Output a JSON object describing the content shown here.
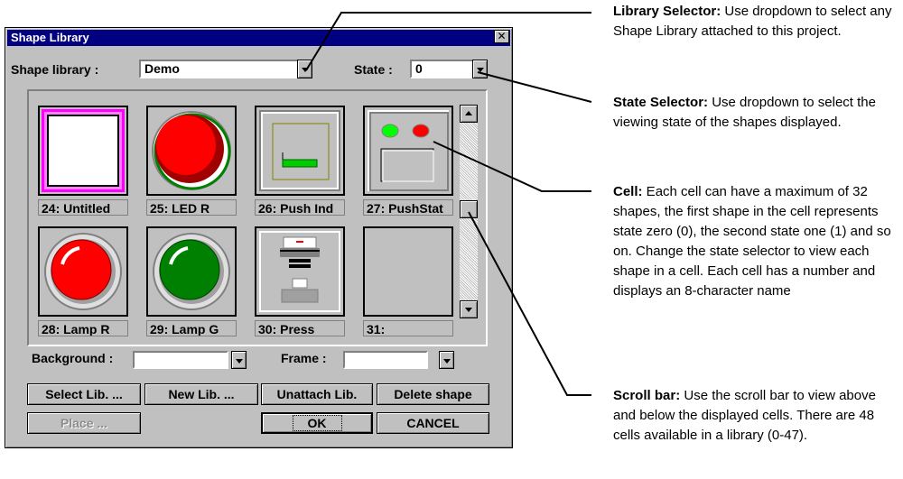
{
  "window": {
    "title": "Shape Library",
    "close": "✕"
  },
  "top": {
    "library_label": "Shape library :",
    "library_value": "Demo",
    "state_label": "State :",
    "state_value": "0"
  },
  "cells": [
    {
      "label": "24: Untitled"
    },
    {
      "label": "25: LED R"
    },
    {
      "label": "26: Push Ind"
    },
    {
      "label": "27: PushStat"
    },
    {
      "label": "28: Lamp R"
    },
    {
      "label": "29: Lamp G"
    },
    {
      "label": "30: Press"
    },
    {
      "label": "31:"
    }
  ],
  "bottom": {
    "background_label": "Background :",
    "frame_label": "Frame :"
  },
  "buttons": {
    "select_lib": "Select Lib. ...",
    "new_lib": "New Lib. ...",
    "unattach_lib": "Unattach Lib.",
    "delete_shape": "Delete shape",
    "place": "Place ...",
    "ok": "OK",
    "cancel": "CANCEL"
  },
  "callouts": {
    "library": {
      "title": "Library Selector:",
      "text": " Use dropdown to select any Shape Library attached to this project."
    },
    "state": {
      "title": "State Selector:",
      "text": " Use dropdown to select the viewing state of the shapes displayed."
    },
    "cell": {
      "title": "Cell:",
      "text": " Each cell can have a maximum of 32 shapes, the first shape in the cell represents state zero (0), the second state one (1) and so on. Change the state selector to view each shape in a cell. Each cell has a number and displays an 8-character name"
    },
    "scroll": {
      "title": "Scroll bar:",
      "text": " Use the scroll bar to view above and below the displayed cells. There are 48 cells available in a library (0-47)."
    }
  },
  "colors": {
    "titlebar": "#000080",
    "face": "#c0c0c0",
    "selection": "#ff00ff",
    "led_red": "#ff0000",
    "led_green": "#008000"
  }
}
